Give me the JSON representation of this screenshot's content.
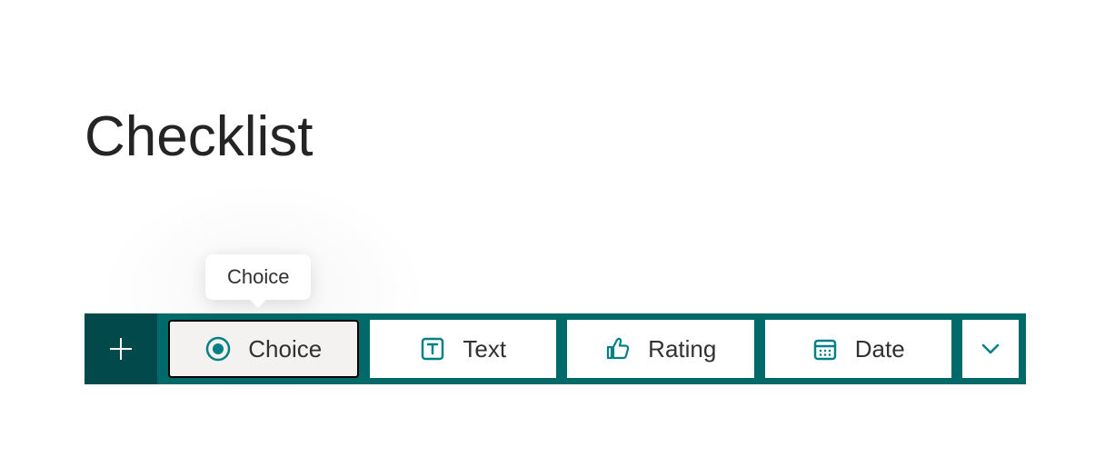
{
  "title": "Checklist",
  "tooltip": "Choice",
  "toolbar": {
    "options": [
      {
        "label": "Choice",
        "selected": true
      },
      {
        "label": "Text",
        "selected": false
      },
      {
        "label": "Rating",
        "selected": false
      },
      {
        "label": "Date",
        "selected": false
      }
    ]
  },
  "colors": {
    "primary": "#00696a",
    "primaryDark": "#01494b",
    "iconTeal": "#038085"
  }
}
